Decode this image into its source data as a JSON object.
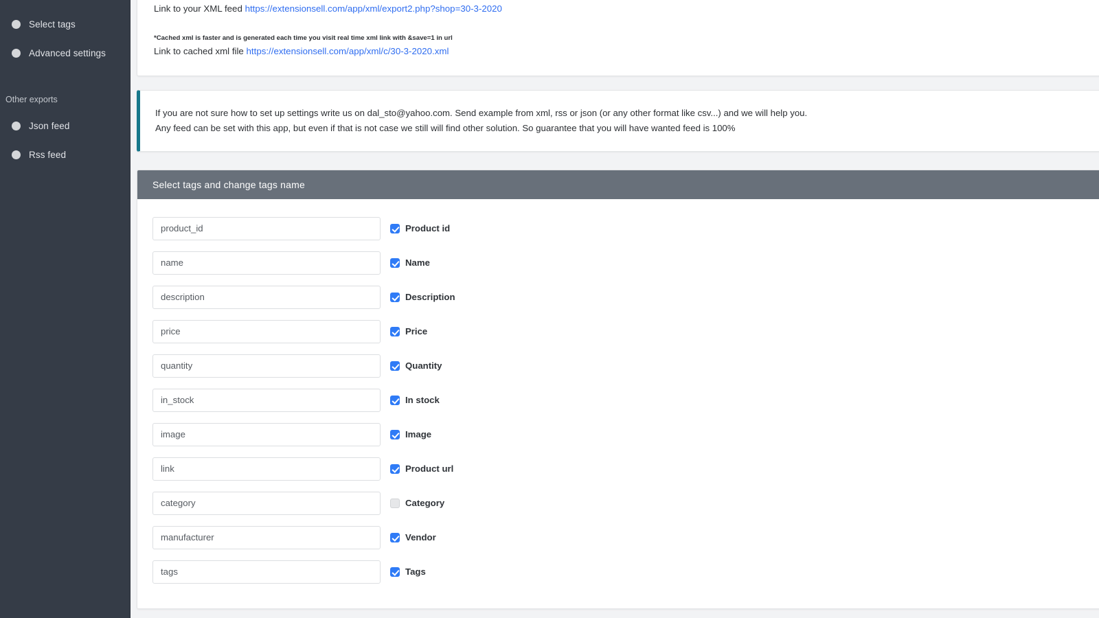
{
  "sidebar": {
    "items": [
      {
        "label": "Select tags",
        "icon": "circle-bullet-icon"
      },
      {
        "label": "Advanced settings",
        "icon": "circle-bullet-icon"
      }
    ],
    "group_title": "Other exports",
    "other_items": [
      {
        "label": "Json feed",
        "icon": "circle-bullet-icon"
      },
      {
        "label": "Rss feed",
        "icon": "circle-bullet-icon"
      }
    ],
    "background_color": "#353c47"
  },
  "links_card": {
    "xml_feed_label": "Link to your XML feed",
    "xml_feed_url": "https://extensionsell.com/app/xml/export2.php?shop=30-3-2020",
    "cached_note": "*Cached xml is faster and is generated each time you visit real time xml link with &save=1 in url",
    "cached_label": "Link to cached xml file",
    "cached_url": "https://extensionsell.com/app/xml/c/30-3-2020.xml",
    "link_color": "#2f6df0"
  },
  "info_card": {
    "line1": "If you are not sure how to set up settings write us on dal_sto@yahoo.com. Send example from xml, rss or json (or any other format like csv...) and we will help you.",
    "line2": "Any feed can be set with this app, but even if that is not case we still will find other solution. So guarantee that you will have wanted feed is 100%",
    "accent_color": "#17788b"
  },
  "tags_panel": {
    "header": "Select tags and change tags name",
    "header_color": "#68707a",
    "checked_color": "#2f7bf6",
    "rows": [
      {
        "value": "product_id",
        "label": "Product id",
        "checked": true
      },
      {
        "value": "name",
        "label": "Name",
        "checked": true
      },
      {
        "value": "description",
        "label": "Description",
        "checked": true
      },
      {
        "value": "price",
        "label": "Price",
        "checked": true
      },
      {
        "value": "quantity",
        "label": "Quantity",
        "checked": true
      },
      {
        "value": "in_stock",
        "label": "In stock",
        "checked": true
      },
      {
        "value": "image",
        "label": "Image",
        "checked": true
      },
      {
        "value": "link",
        "label": "Product url",
        "checked": true
      },
      {
        "value": "category",
        "label": "Category",
        "checked": false
      },
      {
        "value": "manufacturer",
        "label": "Vendor",
        "checked": true
      },
      {
        "value": "tags",
        "label": "Tags",
        "checked": true
      }
    ]
  }
}
